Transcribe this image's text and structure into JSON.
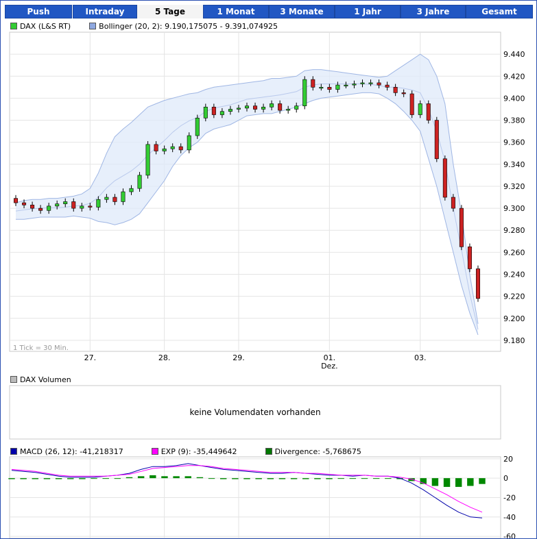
{
  "tabs": [
    {
      "label": "Push"
    },
    {
      "label": "Intraday"
    },
    {
      "label": "5 Tage",
      "active": true
    },
    {
      "label": "1 Monat"
    },
    {
      "label": "3 Monate"
    },
    {
      "label": "1 Jahr"
    },
    {
      "label": "3 Jahre"
    },
    {
      "label": "Gesamt"
    }
  ],
  "legend_main": {
    "series": "DAX (L&S RT)",
    "series_color": "#33cc33",
    "bollinger": "Bollinger (20, 2): 9.190,175075 - 9.391,074925",
    "bollinger_color": "#8fa8e0"
  },
  "legend_volume": {
    "label": "DAX Volumen",
    "color": "#bbbbbb"
  },
  "volume_message": "keine Volumendaten vorhanden",
  "legend_macd": {
    "macd": "MACD (26, 12): -41,218317",
    "macd_color": "#0000aa",
    "exp": "EXP (9): -35,449642",
    "exp_color": "#ff00ff",
    "divergence": "Divergence: -5,768675",
    "divergence_color": "#007700"
  },
  "tick_note": "1 Tick = 30 Min.",
  "chart_data": [
    {
      "type": "candlestick",
      "ylim": [
        9170,
        9460
      ],
      "y_ticks": [
        "9.180",
        "9.200",
        "9.220",
        "9.240",
        "9.260",
        "9.280",
        "9.300",
        "9.320",
        "9.340",
        "9.360",
        "9.380",
        "9.400",
        "9.420",
        "9.440"
      ],
      "y_tick_values": [
        9180,
        9200,
        9220,
        9240,
        9260,
        9280,
        9300,
        9320,
        9340,
        9360,
        9380,
        9400,
        9420,
        9440
      ],
      "x_ticks": [
        "27.",
        "28.",
        "29.",
        "01.",
        "03."
      ],
      "x_tick_sub": [
        "",
        "",
        "",
        "Dez.",
        ""
      ],
      "x_tick_pos": [
        9.5,
        18.5,
        27.5,
        38.5,
        49.5
      ],
      "x_range": [
        0,
        57
      ],
      "grid": true,
      "close": [
        9305,
        9303,
        9300,
        9298,
        9302,
        9304,
        9306,
        9300,
        9302,
        9301,
        9308,
        9310,
        9306,
        9315,
        9318,
        9330,
        9358,
        9352,
        9354,
        9356,
        9353,
        9366,
        9382,
        9392,
        9385,
        9388,
        9390,
        9391,
        9393,
        9390,
        9392,
        9395,
        9389,
        9390,
        9393,
        9417,
        9410,
        9410,
        9408,
        9412,
        9412,
        9413,
        9414,
        9414,
        9412,
        9410,
        9405,
        9404,
        9385,
        9395,
        9380,
        9345,
        9310,
        9300,
        9265,
        9245,
        9218
      ],
      "upper": [
        9305,
        9307,
        9308,
        9308,
        9309,
        9309,
        9310,
        9311,
        9313,
        9318,
        9332,
        9350,
        9365,
        9372,
        9378,
        9385,
        9392,
        9395,
        9398,
        9400,
        9402,
        9404,
        9405,
        9408,
        9410,
        9411,
        9412,
        9413,
        9414,
        9415,
        9416,
        9418,
        9418,
        9419,
        9420,
        9425,
        9426,
        9426,
        9425,
        9424,
        9423,
        9422,
        9421,
        9420,
        9419,
        9420,
        9425,
        9430,
        9435,
        9440,
        9435,
        9420,
        9395,
        9340,
        9295,
        9240,
        9195
      ],
      "lower": [
        9290,
        9290,
        9291,
        9292,
        9292,
        9292,
        9292,
        9293,
        9292,
        9291,
        9288,
        9287,
        9285,
        9287,
        9290,
        9295,
        9305,
        9315,
        9325,
        9338,
        9348,
        9355,
        9360,
        9368,
        9372,
        9374,
        9376,
        9380,
        9384,
        9385,
        9386,
        9386,
        9388,
        9390,
        9392,
        9395,
        9398,
        9400,
        9401,
        9402,
        9403,
        9404,
        9405,
        9405,
        9404,
        9400,
        9395,
        9388,
        9380,
        9370,
        9345,
        9320,
        9290,
        9260,
        9230,
        9205,
        9185
      ]
    },
    {
      "type": "line",
      "ylim": [
        -62,
        22
      ],
      "y_ticks": [
        "20",
        "0",
        "-20",
        "-40",
        "-60"
      ],
      "y_tick_values": [
        20,
        0,
        -20,
        -40,
        -60
      ],
      "series": [
        {
          "name": "MACD (26, 12)",
          "values": [
            8,
            7,
            6,
            4,
            2,
            1,
            1,
            1,
            2,
            3,
            5,
            9,
            12,
            12,
            13,
            15,
            13,
            11,
            9,
            8,
            7,
            6,
            5,
            5,
            6,
            5,
            4,
            3,
            3,
            2,
            3,
            2,
            2,
            0,
            -5,
            -12,
            -20,
            -28,
            -35,
            -40,
            -41
          ]
        },
        {
          "name": "EXP (9)",
          "values": [
            9,
            8,
            7,
            5,
            3,
            2,
            2,
            2,
            2,
            3,
            4,
            7,
            10,
            11,
            12,
            13,
            13,
            12,
            10,
            9,
            8,
            7,
            6,
            6,
            6,
            5,
            5,
            4,
            3,
            3,
            3,
            2,
            2,
            1,
            -1,
            -5,
            -11,
            -17,
            -24,
            -30,
            -35
          ]
        },
        {
          "name": "Divergence",
          "values": [
            -1,
            -1,
            -1,
            -1,
            -1,
            -1,
            -1,
            0,
            0,
            0,
            1,
            2,
            3,
            2,
            2,
            2,
            1,
            0,
            -1,
            -1,
            -1,
            -1,
            -1,
            -1,
            -1,
            -1,
            -1,
            -1,
            0,
            0,
            0,
            0,
            0,
            -1,
            -3,
            -6,
            -8,
            -9,
            -9,
            -8,
            -6
          ]
        }
      ]
    }
  ]
}
